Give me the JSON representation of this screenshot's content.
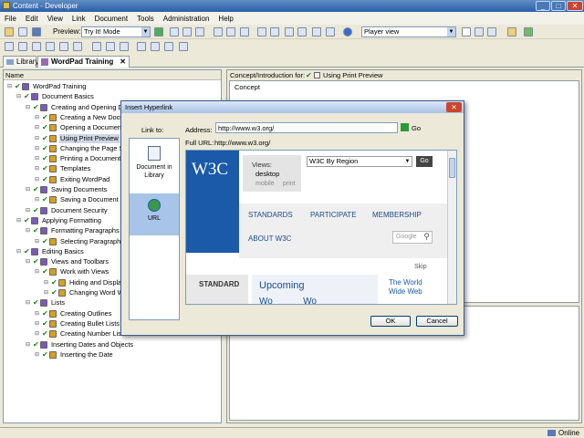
{
  "window": {
    "title": "Content - Developer",
    "minimize_glyph": "_",
    "maximize_glyph": "□",
    "close_glyph": "✕"
  },
  "menu": [
    "File",
    "Edit",
    "View",
    "Link",
    "Document",
    "Tools",
    "Administration",
    "Help"
  ],
  "toolbar": {
    "preview_label": "Preview:",
    "preview_mode": "Try It! Mode",
    "player_view": "Player view"
  },
  "tabs": [
    {
      "label": "Library"
    },
    {
      "label": "WordPad Training",
      "close": "✕"
    }
  ],
  "tree": {
    "header": "Name",
    "items": [
      {
        "label": "WordPad Training",
        "level": 0
      },
      {
        "label": "Document Basics",
        "level": 1
      },
      {
        "label": "Creating and Opening Do",
        "level": 2
      },
      {
        "label": "Creating a New Docu",
        "level": 3
      },
      {
        "label": "Opening a Document",
        "level": 3
      },
      {
        "label": "Using Print Preview",
        "level": 3,
        "selected": true
      },
      {
        "label": "Changing the Page S",
        "level": 3
      },
      {
        "label": "Printing a Document",
        "level": 3
      },
      {
        "label": "Templates",
        "level": 3
      },
      {
        "label": "Exiting WordPad",
        "level": 3
      },
      {
        "label": "Saving Documents",
        "level": 2
      },
      {
        "label": "Saving a Document a",
        "level": 3
      },
      {
        "label": "Document Security",
        "level": 2
      },
      {
        "label": "Applying Formatting",
        "level": 1
      },
      {
        "label": "Formatting Paragraphs",
        "level": 2
      },
      {
        "label": "Selecting Paragraph T",
        "level": 3
      },
      {
        "label": "Editing Basics",
        "level": 1
      },
      {
        "label": "Views and Toolbars",
        "level": 2
      },
      {
        "label": "Work with Views",
        "level": 3
      },
      {
        "label": "Hiding and Display",
        "level": 4
      },
      {
        "label": "Changing Word W",
        "level": 4
      },
      {
        "label": "Lists",
        "level": 2
      },
      {
        "label": "Creating Outlines",
        "level": 3
      },
      {
        "label": "Creating Bullet Lists",
        "level": 3
      },
      {
        "label": "Creating Number Lists",
        "level": 3
      },
      {
        "label": "Inserting Dates and Objects",
        "level": 2
      },
      {
        "label": "Inserting the Date",
        "level": 3
      }
    ]
  },
  "right": {
    "concept_for_label": "Concept/Introduction for:",
    "concept_for_value": "Using Print Preview",
    "concept_tab": "Concept"
  },
  "dialog": {
    "title": "Insert Hyperlink",
    "close": "✕",
    "link_to_label": "Link to:",
    "options": [
      {
        "label": "Document in Library"
      },
      {
        "label": "URL",
        "selected": true
      }
    ],
    "address_label": "Address:",
    "address_value": "http://www.w3.org/",
    "go_label": "Go",
    "full_url_label": "Full URL:",
    "full_url_value": "http://www.w3.org/",
    "ok_label": "OK",
    "cancel_label": "Cancel"
  },
  "web": {
    "logo": "W3C",
    "views_label": "Views:",
    "views": [
      "desktop",
      "mobile",
      "print"
    ],
    "region": "W3C By Region",
    "go": "Go",
    "nav": [
      "STANDARDS",
      "PARTICIPATE",
      "MEMBERSHIP",
      "ABOUT W3C"
    ],
    "search_brand": "Google",
    "skip": "Skip",
    "standards_box": "STANDARD",
    "upcoming": "Upcoming",
    "upcoming_cut": "Wo            Wo",
    "world_wide_web": "The World Wide Web"
  },
  "status": {
    "online": "Online"
  }
}
